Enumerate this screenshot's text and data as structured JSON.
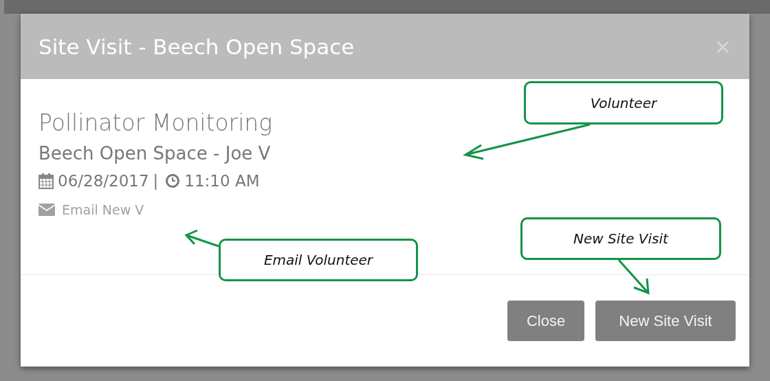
{
  "modal": {
    "title": "Site Visit - Beech Open Space",
    "close_glyph": "×",
    "event": "Pollinator Monitoring",
    "location": "Beech Open Space - Joe V",
    "date": "06/28/2017",
    "separator": "|",
    "time": "11:10 AM",
    "email_link": "Email New V",
    "buttons": [
      {
        "label": "Close"
      },
      {
        "label": "New Site Visit"
      }
    ]
  },
  "annotations": [
    {
      "label": "Volunteer"
    },
    {
      "label": "Email Volunteer"
    },
    {
      "label": "New Site Visit"
    }
  ]
}
